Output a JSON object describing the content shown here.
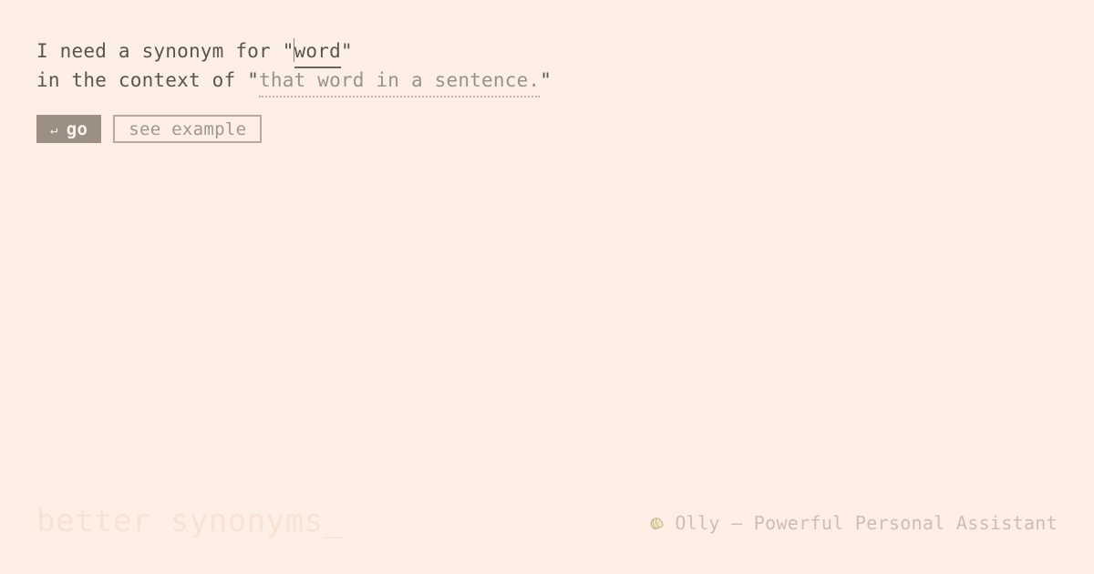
{
  "colors": {
    "background": "#fdeee6",
    "text": "#5a5550",
    "placeholder": "#9a938b",
    "accent_button": "#9b9083",
    "accent_button_text": "#fdf3ec",
    "outline_button_border": "#b9aa9c",
    "outline_button_text": "#a2988c",
    "brand": "#f7e2d4",
    "credit": "#cbbfb5"
  },
  "prompt": {
    "line1_before": "I need a synonym for ",
    "open_quote": "\"",
    "word_value": "word",
    "close_quote": "\"",
    "line2_before": "in the context of ",
    "context_placeholder": "that word in a sentence."
  },
  "actions": {
    "go_icon": "↵",
    "go_label": "go",
    "example_label": "see example"
  },
  "footer": {
    "brand": "better synonyms_",
    "credit_icon": "olly-shell-icon",
    "credit": "Olly — Powerful Personal Assistant"
  }
}
